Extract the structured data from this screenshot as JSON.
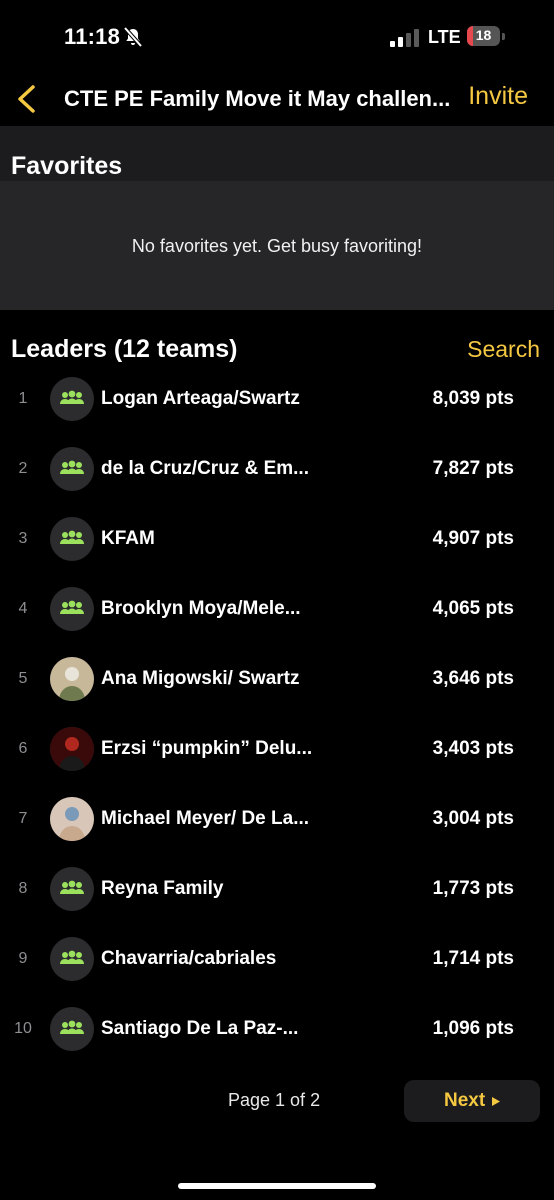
{
  "status_bar": {
    "time": "11:18",
    "network": "LTE",
    "battery": "18",
    "battery_level": 0.18,
    "battery_color": "#e5484d"
  },
  "nav": {
    "title": "CTE PE Family Move it May challen...",
    "invite_label": "Invite"
  },
  "favorites": {
    "title": "Favorites",
    "empty_text": "No favorites yet. Get busy favoriting!"
  },
  "leaders": {
    "title": "Leaders (12 teams)",
    "search_label": "Search",
    "rows": [
      {
        "rank": "1",
        "name": "Logan Arteaga/Swartz",
        "points": "8,039 pts",
        "avatar": "team-icon"
      },
      {
        "rank": "2",
        "name": "de la Cruz/Cruz & Em...",
        "points": "7,827 pts",
        "avatar": "team-icon"
      },
      {
        "rank": "3",
        "name": "KFAM",
        "points": "4,907 pts",
        "avatar": "team-icon"
      },
      {
        "rank": "4",
        "name": "Brooklyn Moya/Mele...",
        "points": "4,065 pts",
        "avatar": "team-icon"
      },
      {
        "rank": "5",
        "name": "Ana Migowski/ Swartz",
        "points": "3,646 pts",
        "avatar": "photo"
      },
      {
        "rank": "6",
        "name": "Erzsi “pumpkin” Delu...",
        "points": "3,403 pts",
        "avatar": "photo"
      },
      {
        "rank": "7",
        "name": "Michael Meyer/ De La...",
        "points": "3,004 pts",
        "avatar": "photo"
      },
      {
        "rank": "8",
        "name": "Reyna Family",
        "points": "1,773 pts",
        "avatar": "team-icon"
      },
      {
        "rank": "9",
        "name": "Chavarria/cabriales",
        "points": "1,714 pts",
        "avatar": "team-icon"
      },
      {
        "rank": "10",
        "name": "Santiago De La Paz-...",
        "points": "1,096 pts",
        "avatar": "team-icon"
      }
    ]
  },
  "pagination": {
    "page_info": "Page 1 of 2",
    "next_label": "Next"
  },
  "colors": {
    "accent": "#f5c842",
    "team_icon": "#9be15d",
    "background": "#000000",
    "section": "#1c1c1e"
  }
}
